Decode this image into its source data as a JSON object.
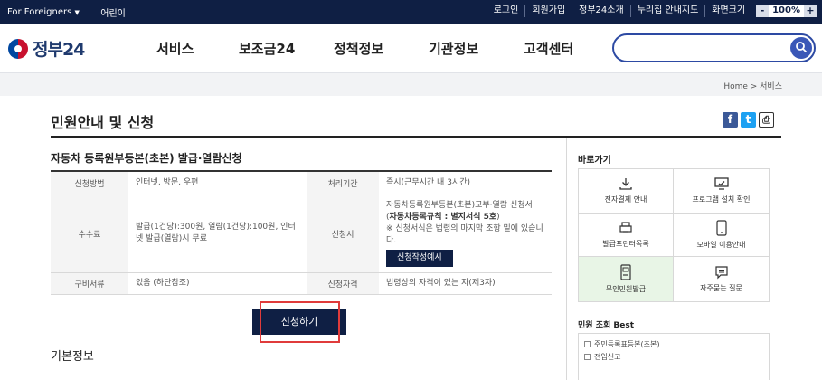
{
  "topbar": {
    "foreigners": "For Foreigners",
    "foreigners_caret": "▼",
    "kids": "어린이",
    "links": [
      "로그인",
      "회원가입",
      "정부24소개",
      "누리집 안내지도"
    ],
    "zoom_label": "화면크기",
    "zoom_minus": "-",
    "zoom_value": "100%",
    "zoom_plus": "+"
  },
  "header": {
    "logo": "정부24",
    "nav": [
      "서비스",
      "보조금24",
      "정책정보",
      "기관정보",
      "고객센터"
    ],
    "search_placeholder": ""
  },
  "breadcrumb": "Home > 서비스",
  "page_title": "민원안내 및 신청",
  "share": {
    "facebook": "f",
    "twitter": "t",
    "print": "⎙"
  },
  "service": {
    "name": "자동차 등록원부등본(초본) 발급·열람신청",
    "rows": {
      "method_label": "신청방법",
      "method_value": "인터넷, 방문, 우편",
      "period_label": "처리기간",
      "period_value": "즉시(근무시간 내 3시간)",
      "fee_label": "수수료",
      "fee_value": "발급(1건당):300원, 열람(1건당):100원, 인터넷 발급(열람)시 무료",
      "form_label": "신청서",
      "form_line1": "자동차등록원부등본(초본)교부·열람 신청서 (",
      "form_line1_bold": "자동차등록규칙 : 별지서식 5호",
      "form_line1_end": ")",
      "form_line2": "※ 신청서식은 법령의 마지막 조항 밑에 있습니다.",
      "form_button": "신청작성예시",
      "docs_label": "구비서류",
      "docs_value": "있음 (하단참조)",
      "eligibility_label": "신청자격",
      "eligibility_value": "법령상의 자격이 있는 자(제3자)"
    },
    "apply_button": "신청하기"
  },
  "basic_info": "기본정보",
  "sidebar": {
    "title": "바로가기",
    "quick": [
      {
        "label": "전자결제 안내",
        "icon": "download-icon"
      },
      {
        "label": "프로그램 설치 확인",
        "icon": "monitor-icon"
      },
      {
        "label": "발급프린터목록",
        "icon": "printer-icon"
      },
      {
        "label": "모바일 이용안내",
        "icon": "mobile-icon"
      },
      {
        "label": "무인민원발급",
        "icon": "kiosk-icon"
      },
      {
        "label": "자주묻는 질문",
        "icon": "chat-icon"
      }
    ],
    "best_title": "민원 조회 Best",
    "best": [
      "주민등록표등본(초본)",
      "전입신고"
    ]
  },
  "colors": {
    "navy": "#0f1f44",
    "search_border": "#2d4aa3",
    "highlight": "#e03b3b",
    "active_cell": "#e8f5e6"
  }
}
